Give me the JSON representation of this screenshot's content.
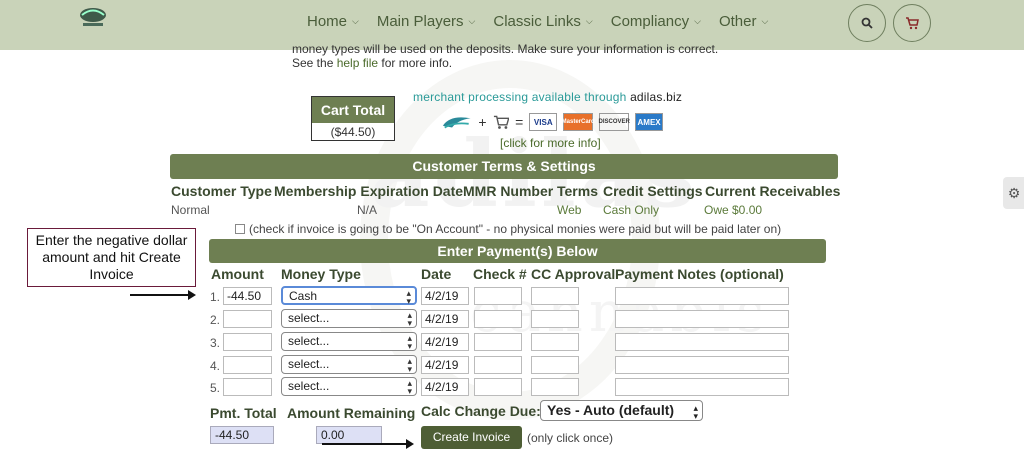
{
  "nav": {
    "items": [
      {
        "label": "Home"
      },
      {
        "label": "Main Players"
      },
      {
        "label": "Classic Links"
      },
      {
        "label": "Compliancy"
      },
      {
        "label": "Other"
      }
    ],
    "icons": [
      "search-icon",
      "cart-icon"
    ]
  },
  "intro": {
    "line1": "money types will be used on the deposits. Make sure your information is correct.",
    "line2_prefix": "See the ",
    "line2_link": "help file",
    "line2_suffix": " for more info."
  },
  "cart": {
    "title": "Cart Total",
    "value": "($44.50)"
  },
  "merchant": {
    "text": "merchant processing available through ",
    "domain": "adilas.biz",
    "cards": [
      "VISA",
      "MasterCard",
      "DISCOVER",
      "AMEX"
    ],
    "more_info": "[click for more info]"
  },
  "customer": {
    "section_title": "Customer Terms & Settings",
    "headers": [
      "Customer Type",
      "Membership Expiration Date",
      "MMR Number",
      "Terms",
      "Credit Settings",
      "Current Receivables"
    ],
    "values": {
      "type": "Normal",
      "expiration": "N/A",
      "mmr": "",
      "terms": "Web",
      "credit": "Cash Only",
      "receivables": "Owe $0.00"
    },
    "on_account_text": "(check if invoice is going to be \"On Account\" - no physical monies were paid but will be paid later on)"
  },
  "annotation": {
    "text": "Enter the negative dollar amount and hit Create Invoice"
  },
  "payments": {
    "section_title": "Enter Payment(s) Below",
    "headers": [
      "Amount",
      "Money Type",
      "Date",
      "Check #",
      "CC Approval",
      "Payment Notes (optional)"
    ],
    "rows": [
      {
        "num": "1.",
        "amount": "-44.50",
        "money_type": "Cash",
        "date": "4/2/19"
      },
      {
        "num": "2.",
        "amount": "",
        "money_type": "select...",
        "date": "4/2/19"
      },
      {
        "num": "3.",
        "amount": "",
        "money_type": "select...",
        "date": "4/2/19"
      },
      {
        "num": "4.",
        "amount": "",
        "money_type": "select...",
        "date": "4/2/19"
      },
      {
        "num": "5.",
        "amount": "",
        "money_type": "select...",
        "date": "4/2/19"
      }
    ]
  },
  "totals": {
    "pmt_total_label": "Pmt. Total",
    "pmt_total": "-44.50",
    "remaining_label": "Amount Remaining",
    "remaining": "0.00",
    "calc_label": "Calc Change Due:",
    "calc_value": "Yes - Auto (default)",
    "create_button": "Create Invoice",
    "only_once": "(only click once)"
  },
  "colors": {
    "brand": "#6e7f52",
    "nav_bg": "#c9d3b9",
    "button": "#4e5e35"
  }
}
